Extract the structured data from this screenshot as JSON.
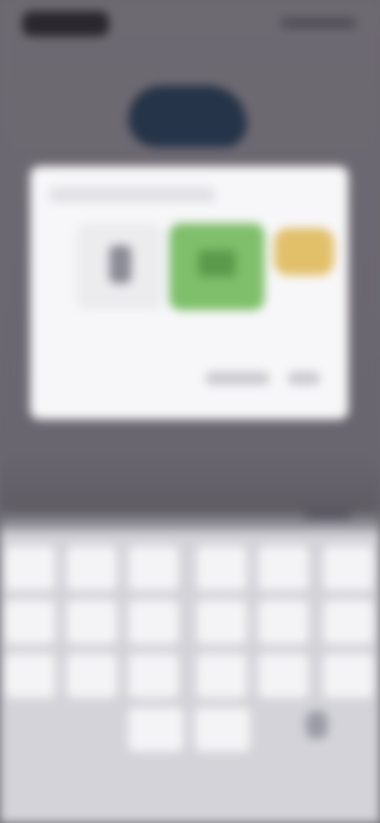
{
  "colors": {
    "backdrop": "#6b6870",
    "dialog": "#f7f7f9",
    "option_green": "#7fbf6b",
    "option_yellow": "#e2c06a",
    "keyboard": "#d3d3d9",
    "key": "#f4f4f6"
  },
  "icons": {
    "app_logo": "app-logo-icon",
    "mic": "microphone-icon"
  }
}
